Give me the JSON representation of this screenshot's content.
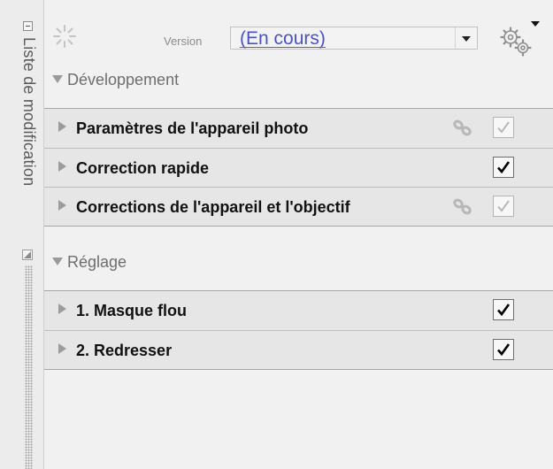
{
  "side_panel": {
    "title": "Liste de modification"
  },
  "header": {
    "version_label": "Version",
    "version_value": "(En cours)"
  },
  "sections": [
    {
      "label": "Développement",
      "items": [
        {
          "label": "Paramètres de l'appareil photo",
          "checked": true,
          "enabled": false,
          "linked": true
        },
        {
          "label": "Correction rapide",
          "checked": true,
          "enabled": true,
          "linked": false
        },
        {
          "label": "Corrections de l'appareil et l'objectif",
          "checked": true,
          "enabled": false,
          "linked": true
        }
      ]
    },
    {
      "label": "Réglage",
      "items": [
        {
          "label": "1. Masque flou",
          "checked": true,
          "enabled": true,
          "linked": false
        },
        {
          "label": "2. Redresser",
          "checked": true,
          "enabled": true,
          "linked": false
        }
      ]
    }
  ],
  "colors": {
    "version_text": "#4a52c8",
    "check_enabled": "#000000",
    "check_disabled": "#b8b8b8"
  }
}
